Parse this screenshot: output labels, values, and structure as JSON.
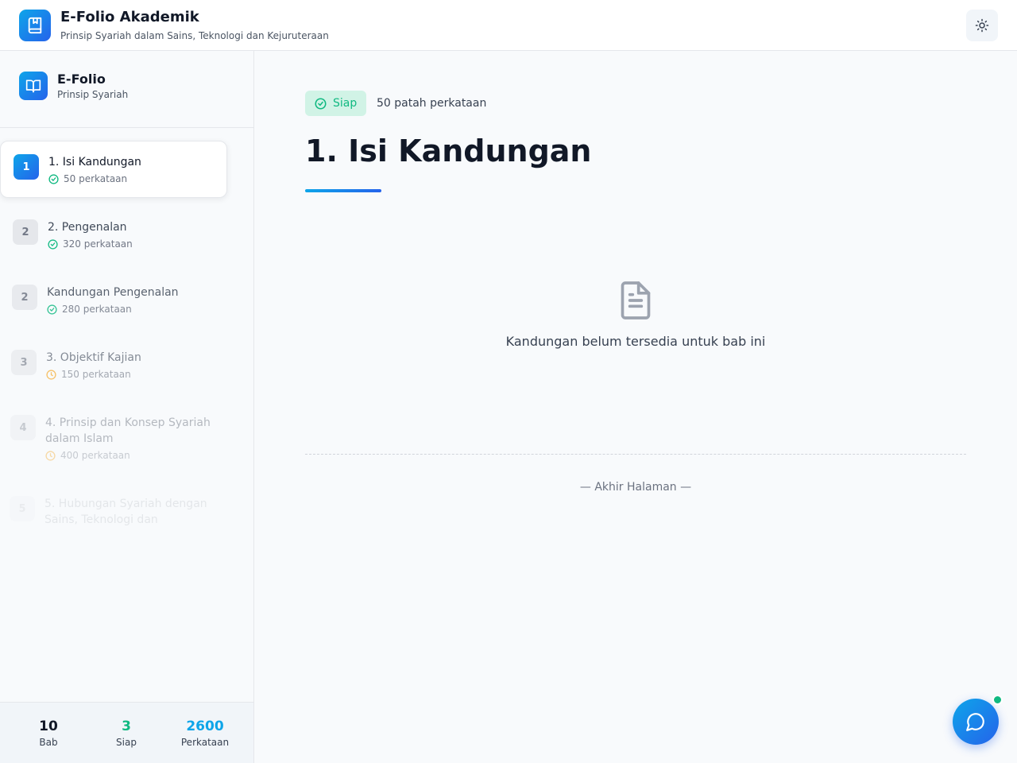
{
  "header": {
    "title": "E-Folio Akademik",
    "subtitle": "Prinsip Syariah dalam Sains, Teknologi dan Kejuruteraan",
    "logo_icon": "book-bookmark-icon",
    "theme_icon": "sun-icon"
  },
  "sidebar": {
    "brand_title": "E-Folio",
    "brand_subtitle": "Prinsip Syariah",
    "brand_icon": "open-book-icon",
    "chapters": [
      {
        "num": "1",
        "title": "1. Isi Kandungan",
        "meta": "50 perkataan",
        "status": "siap",
        "active": true
      },
      {
        "num": "2",
        "title": "2. Pengenalan",
        "meta": "320 perkataan",
        "status": "siap"
      },
      {
        "num": "2",
        "title": "Kandungan Pengenalan",
        "meta": "280 perkataan",
        "status": "siap"
      },
      {
        "num": "3",
        "title": "3. Objektif Kajian",
        "meta": "150 perkataan",
        "status": "pending"
      },
      {
        "num": "4",
        "title": "4. Prinsip dan Konsep Syariah dalam Islam",
        "meta": "400 perkataan",
        "status": "pending"
      },
      {
        "num": "5",
        "title": "5. Hubungan Syariah dengan Sains, Teknologi dan",
        "meta": "",
        "status": "pending"
      }
    ],
    "stats": [
      {
        "value": "10",
        "label": "Bab",
        "color": "#111827"
      },
      {
        "value": "3",
        "label": "Siap",
        "color": "#10b981"
      },
      {
        "value": "2600",
        "label": "Perkataan",
        "color": "#0ea5e9"
      }
    ]
  },
  "main": {
    "status_badge": "Siap",
    "word_count": "50 patah perkataan",
    "title": "1. Isi Kandungan",
    "empty_message": "Kandungan belum tersedia untuk bab ini",
    "end_text": "— Akhir Halaman —",
    "empty_icon": "document-icon"
  },
  "chat": {
    "icon": "chat-bubble-icon"
  },
  "colors": {
    "accent": "#0ea5e9",
    "accent_dark": "#2563eb",
    "success": "#10b981",
    "pending": "#f59e0b"
  }
}
